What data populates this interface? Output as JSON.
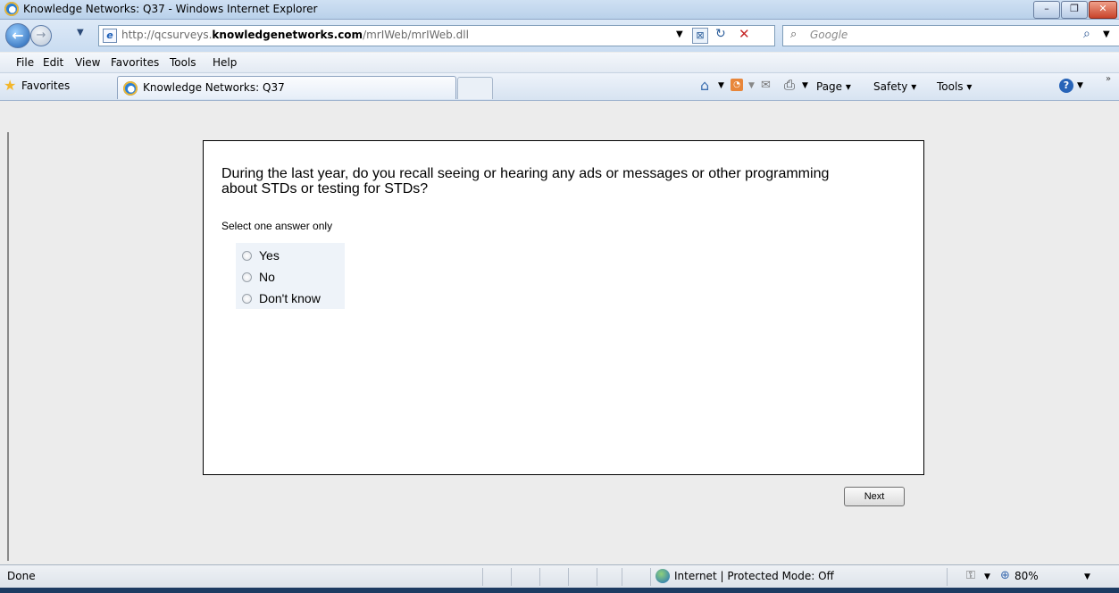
{
  "window": {
    "title": "Knowledge Networks: Q37 - Windows Internet Explorer",
    "minimize": "–",
    "restore": "❐",
    "close": "✕"
  },
  "address": {
    "url_prefix": "http://qcsurveys.",
    "url_domain": "knowledgenetworks.com",
    "url_suffix": "/mrIWeb/mrIWeb.dll",
    "search_placeholder": "Google"
  },
  "menu": {
    "items": [
      "File",
      "Edit",
      "View",
      "Favorites",
      "Tools",
      "Help"
    ]
  },
  "favorites_bar": {
    "favorites_label": "Favorites",
    "tab_title": "Knowledge Networks: Q37",
    "commands": [
      "Page ▾",
      "Safety ▾",
      "Tools ▾"
    ]
  },
  "survey": {
    "question": "During the last year, do you recall seeing or hearing any ads or messages or other programming about STDs or testing for STDs?",
    "instruction": "Select one answer only",
    "options": [
      "Yes",
      "No",
      "Don't know"
    ],
    "next_label": "Next"
  },
  "status_bar": {
    "status_text": "Done",
    "zone_text": "Internet | Protected Mode: Off",
    "zoom": "80%"
  }
}
